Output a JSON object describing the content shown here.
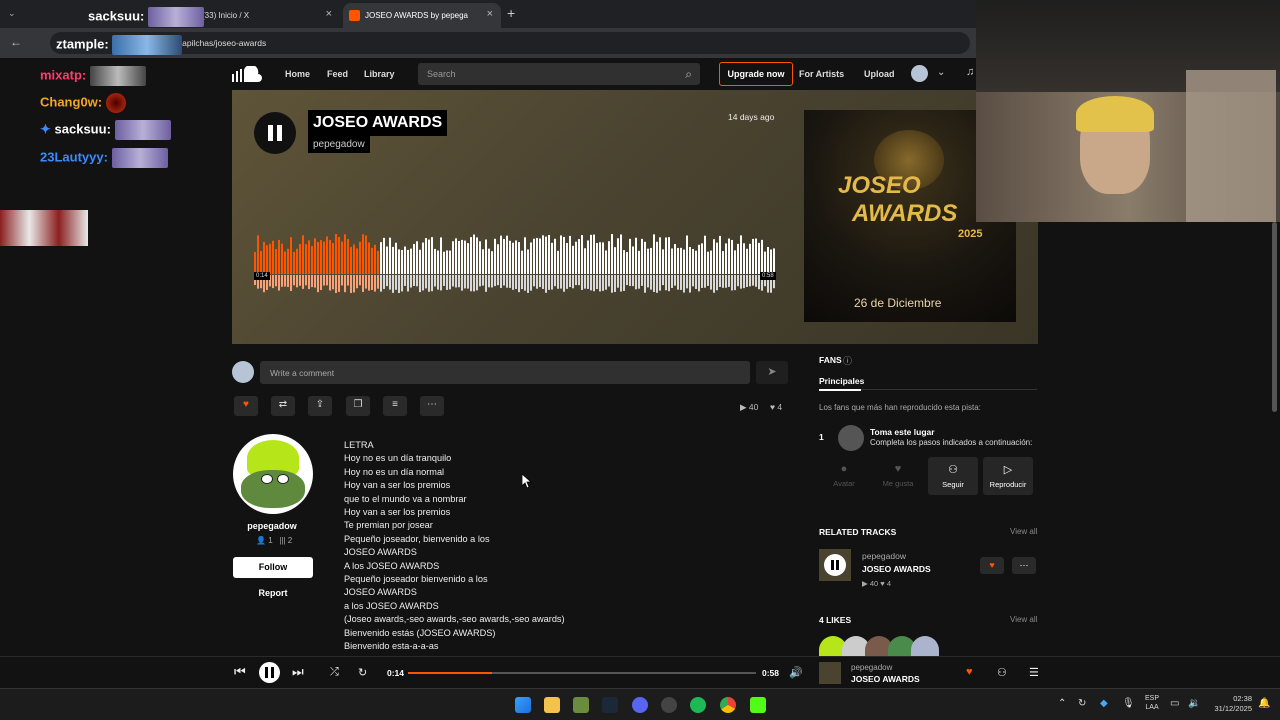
{
  "browser": {
    "tabs": [
      {
        "label": "(33) Inicio / X",
        "active": false
      },
      {
        "label": "JOSEO AWARDS by pepega",
        "active": true
      }
    ],
    "url": "ntapilchas/joseo-awards"
  },
  "chat": {
    "lines": [
      {
        "user": "sacksuu:",
        "color": "#ffffff"
      },
      {
        "user": "ztample:",
        "color": "#ffffff"
      },
      {
        "user": "mixatp:",
        "color": "#ff3b6b"
      },
      {
        "user": "Chang0w:",
        "color": "#f5a623"
      },
      {
        "user": "sacksuu:",
        "color": "#ffffff"
      },
      {
        "user": "23Lautyyy:",
        "color": "#3b8bff"
      }
    ]
  },
  "header": {
    "nav": [
      "Home",
      "Feed",
      "Library"
    ],
    "search_placeholder": "Search",
    "upgrade": "Upgrade now",
    "for_artists": "For Artists",
    "upload": "Upload"
  },
  "track": {
    "title": "JOSEO AWARDS",
    "artist": "pepegadow",
    "posted": "14 days ago",
    "time_current": "0:14",
    "time_total": "0:58",
    "progress": 0.24
  },
  "cover": {
    "line1": "JOSEO",
    "line2": "AWARDS",
    "year": "2025",
    "date": "26 de Diciembre"
  },
  "comment": {
    "placeholder": "Write a comment"
  },
  "stats": {
    "plays": "40",
    "likes": "4"
  },
  "artist_card": {
    "name": "pepegadow",
    "followers": "1",
    "tracks": "2",
    "follow": "Follow",
    "report": "Report"
  },
  "lyrics": [
    "LETRA",
    "Hoy no es un día tranquilo",
    "Hoy no es un día normal",
    "Hoy van a ser los premios",
    "que to el mundo va a nombrar",
    "Hoy van a ser los premios",
    "Te premian por josear",
    "Pequeño joseador, bienvenido a los",
    "JOSEO AWARDS",
    "A los JOSEO AWARDS",
    "Pequeño joseador bienvenido a los",
    "JOSEO AWARDS",
    "a los JOSEO AWARDS",
    "(Joseo awards,-seo awards,-seo awards,-seo awards)",
    "Bienvenido estás (JOSEO AWARDS)",
    "Bienvenido esta-a-a-as"
  ],
  "fans": {
    "title": "FANS",
    "tab": "Principales",
    "desc": "Los fans que más han reproducido esta pista:",
    "rank": "1",
    "take_title": "Toma este lugar",
    "take_desc": "Completa los pasos indicados a continuación:",
    "steps": [
      "Avatar",
      "Me gusta",
      "Seguir",
      "Reproducir"
    ]
  },
  "related": {
    "title": "RELATED TRACKS",
    "view_all": "View all",
    "artist": "pepegadow",
    "track": "JOSEO AWARDS",
    "plays": "40",
    "likes": "4"
  },
  "likes_section": {
    "title": "4 LIKES",
    "view_all": "View all"
  },
  "player": {
    "current": "0:14",
    "total": "0:58",
    "artist": "pepegadow",
    "track": "JOSEO AWARDS"
  },
  "system": {
    "lang1": "ESP",
    "lang2": "LAA",
    "time": "02:38",
    "date": "31/12/2025"
  },
  "colors": {
    "accent": "#ff5500"
  }
}
